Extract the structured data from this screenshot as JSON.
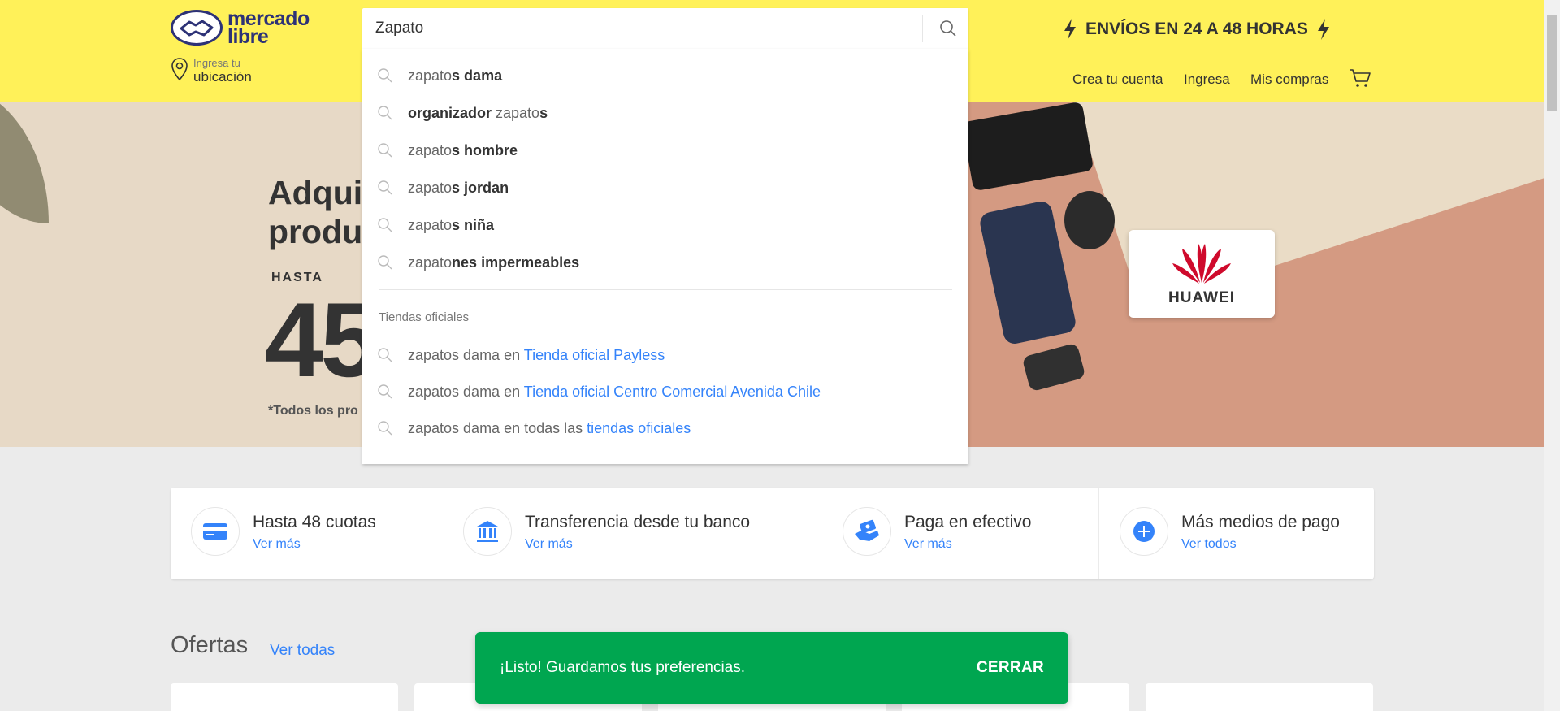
{
  "header": {
    "logo_line1": "mercado",
    "logo_line2": "libre",
    "location_small": "Ingresa tu",
    "location_big": "ubicación",
    "search_value": "Zapato",
    "promo_text": "ENVÍOS EN 24 A 48 HORAS",
    "nav": {
      "create_account": "Crea tu cuenta",
      "login": "Ingresa",
      "purchases": "Mis compras"
    }
  },
  "suggestions": [
    {
      "typed": "zapato",
      "rest": "s dama"
    },
    {
      "prefix": "organizador",
      "typed": " zapato",
      "rest": "s"
    },
    {
      "typed": "zapato",
      "rest": "s hombre"
    },
    {
      "typed": "zapato",
      "rest": "s jordan"
    },
    {
      "typed": "zapato",
      "rest": "s niña"
    },
    {
      "typed": "zapato",
      "rest": "nes impermeables"
    }
  ],
  "stores": {
    "heading": "Tiendas oficiales",
    "items": [
      {
        "text": "zapatos dama en ",
        "link": "Tienda oficial Payless"
      },
      {
        "text": "zapatos dama en ",
        "link": "Tienda oficial Centro Comercial Avenida Chile"
      },
      {
        "text": "zapatos dama en todas las ",
        "link": "tiendas oficiales"
      }
    ]
  },
  "banner": {
    "line1": "Adqui",
    "line2": "produ",
    "hasta": "HASTA",
    "number": "45",
    "terms": "*Todos los pro",
    "brand": "HUAWEI"
  },
  "payments": [
    {
      "title": "Hasta 48 cuotas",
      "link": "Ver más"
    },
    {
      "title": "Transferencia desde tu banco",
      "link": "Ver más"
    },
    {
      "title": "Paga en efectivo",
      "link": "Ver más"
    },
    {
      "title": "Más medios de pago",
      "link": "Ver todos"
    }
  ],
  "ofertas": {
    "title": "Ofertas",
    "link": "Ver todas"
  },
  "toast": {
    "message": "¡Listo! Guardamos tus preferencias.",
    "button": "CERRAR"
  },
  "colors": {
    "header_bg": "#fff159",
    "link": "#3483fa",
    "toast_bg": "#00a650"
  }
}
